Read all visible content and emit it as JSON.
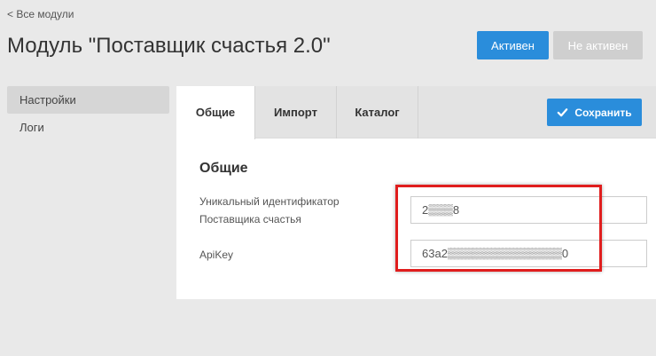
{
  "header": {
    "back_link": "< Все модули",
    "title": "Модуль \"Поставщик счастья 2.0\"",
    "active_button": "Активен",
    "inactive_button": "Не активен"
  },
  "sidebar": {
    "items": [
      {
        "label": "Настройки",
        "selected": true
      },
      {
        "label": "Логи",
        "selected": false
      }
    ]
  },
  "tabs": [
    {
      "label": "Общие",
      "active": true
    },
    {
      "label": "Импорт",
      "active": false
    },
    {
      "label": "Каталог",
      "active": false
    }
  ],
  "save_button": {
    "label": "Сохранить",
    "icon": "check-icon"
  },
  "section": {
    "title": "Общие",
    "fields": [
      {
        "label": "Уникальный идентификатор Поставщика счастья",
        "value": "2▒▒▒8"
      },
      {
        "label": "ApiKey",
        "value": "63a2▒▒▒▒▒▒▒▒▒▒▒▒▒▒0"
      }
    ]
  },
  "colors": {
    "primary": "#2a8ddb",
    "disabled": "#cfcfcf",
    "highlight": "#e01d1d",
    "background": "#e9e9e9"
  }
}
